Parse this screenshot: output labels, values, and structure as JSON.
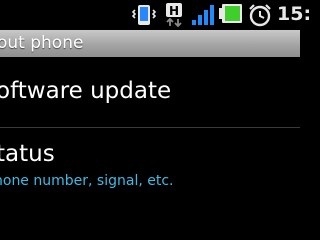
{
  "status_bar": {
    "icons": [
      "vibrate-icon",
      "hspa-data-icon",
      "signal-strength-icon",
      "battery-icon",
      "alarm-clock-icon"
    ],
    "time": "15:",
    "network_label": "H"
  },
  "title_bar": {
    "title": "out phone"
  },
  "items": [
    {
      "title": "oftware update",
      "summary": ""
    },
    {
      "title": "tatus",
      "summary": "hone number, signal, etc."
    }
  ],
  "colors": {
    "summary_text": "#3bbce6",
    "battery": "#3fcf2b",
    "signal": "#1e8cff"
  }
}
